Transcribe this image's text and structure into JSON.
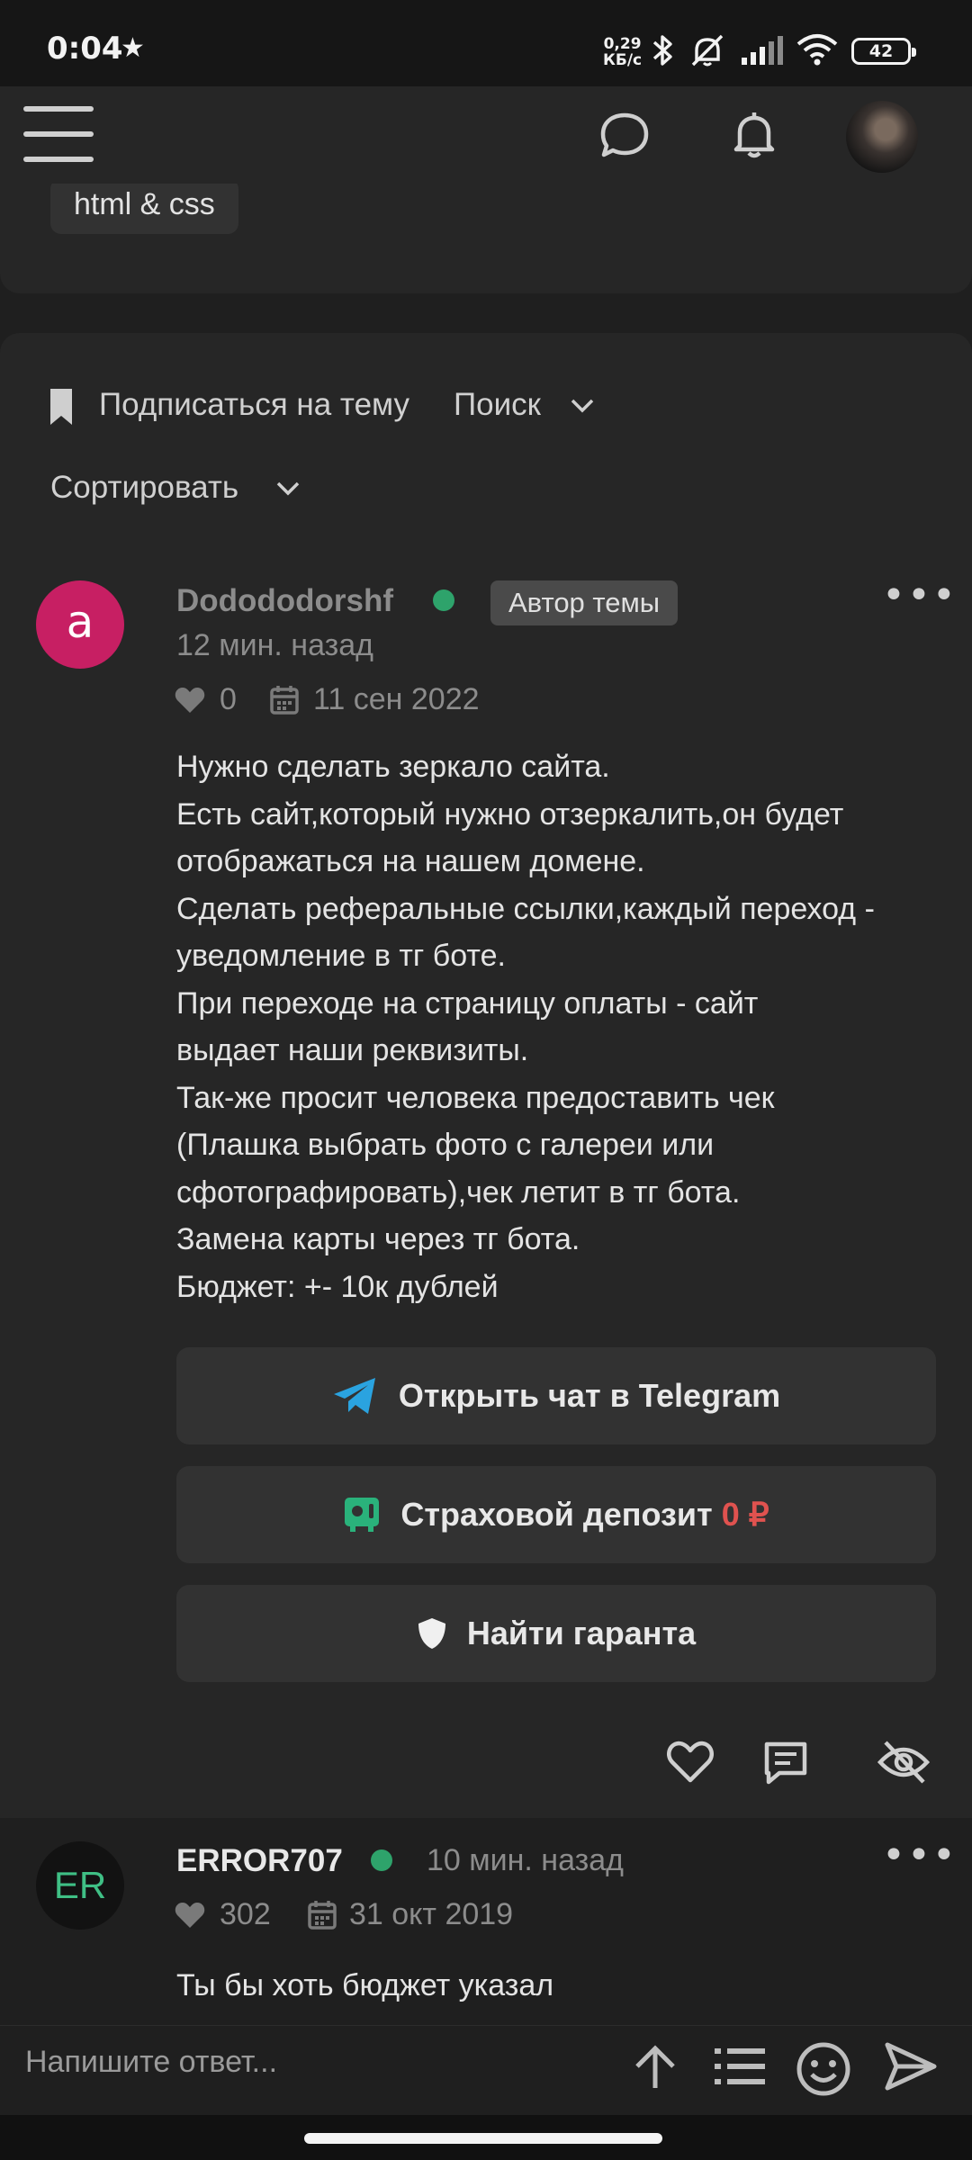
{
  "status_bar": {
    "time": "0:04",
    "star": "★",
    "net_speed_value": "0,29",
    "net_speed_unit": "КБ/с",
    "battery": "42"
  },
  "top_card": {
    "tag": "html & css"
  },
  "thread_controls": {
    "subscribe": "Подписаться на тему",
    "search": "Поиск",
    "sort": "Сортировать"
  },
  "post": {
    "avatar_letter": "a",
    "avatar_color": "#c71f63",
    "username": "Dodododorshf",
    "author_badge": "Автор темы",
    "time": "12 мин. назад",
    "likes": "0",
    "join_date": "11 сен 2022",
    "lines": [
      "Нужно сделать зеркало сайта.",
      "Есть сайт,который нужно отзеркалить,он будет",
      "отображаться на нашем домене.",
      "Сделать реферальные ссылки,каждый переход -",
      "уведомление в тг боте.",
      "При переходе на страницу оплаты - сайт",
      "выдает наши реквизиты.",
      "Так-же просит человека предоставить чек",
      "(Плашка выбрать фото с галереи или",
      "сфотографировать),чек летит в тг бота.",
      "Замена карты через тг бота.",
      "Бюджет: +- 10к дублей"
    ],
    "telegram_button": "Открыть чат в Telegram",
    "deposit_label": "Страховой депозит",
    "deposit_amount": "0 ₽",
    "guarantor_button": "Найти гаранта"
  },
  "reply": {
    "avatar_text": "ER",
    "username": "ERROR707",
    "time": "10 мин. назад",
    "likes": "302",
    "join_date": "31 окт 2019",
    "text": "Ты бы хоть бюджет указал"
  },
  "composer": {
    "placeholder": "Напишите ответ..."
  },
  "colors": {
    "online": "#2ea36b",
    "telegram": "#2aa3e0",
    "deposit_icon": "#2ab27b",
    "deposit_amount": "#e0524f"
  }
}
